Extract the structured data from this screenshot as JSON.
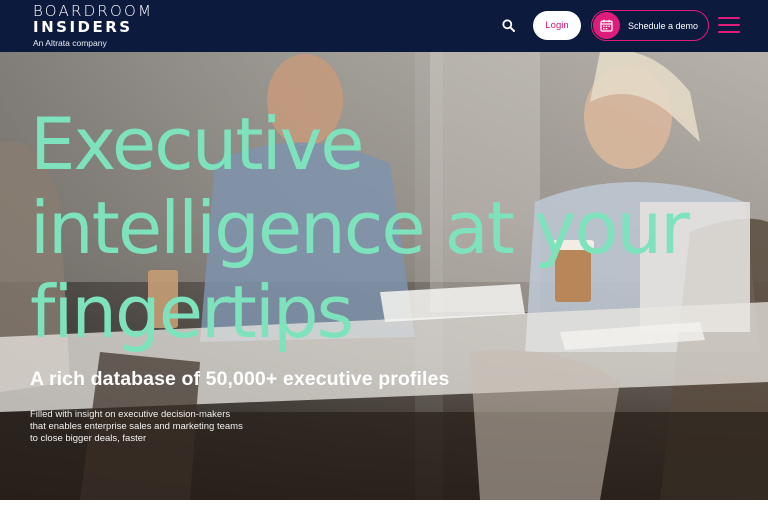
{
  "brand": {
    "line1": "BOARDROOM",
    "line2": "INSIDERS",
    "tagline": "An Altrata company"
  },
  "nav": {
    "search_icon": "search-icon",
    "login_label": "Login",
    "demo_label": "Schedule a demo",
    "demo_icon": "calendar-icon",
    "menu_icon": "hamburger-menu-icon"
  },
  "hero": {
    "title_lines": [
      "Executive",
      "intelligence at your",
      "fingertips"
    ],
    "subtitle": "A rich database of 50,000+ executive profiles",
    "description_lines": [
      "Filled with insight on executive decision-makers",
      "that enables enterprise sales and marketing teams",
      "to close bigger deals, faster"
    ]
  },
  "colors": {
    "header_bg": "#0c1a3d",
    "accent_pink": "#e01c7a",
    "hero_title": "#7ee3bd",
    "white": "#ffffff"
  }
}
